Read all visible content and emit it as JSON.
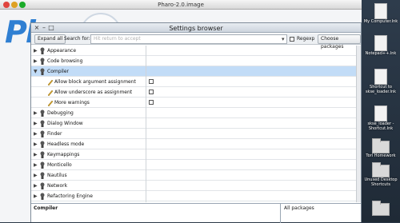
{
  "pharo_window": {
    "title": "Pharo-2.0.image",
    "logo_text": "Ph"
  },
  "settings": {
    "title": "Settings browser",
    "toolbar": {
      "expand_all": "Expand all",
      "search_label": "Search for:",
      "search_placeholder": "Hit return to accept",
      "dropdown_icon": "▾",
      "regexp_label": "Regexp",
      "choose_packages": "Choose packages"
    },
    "tree_rows": [
      {
        "label": "Appearance",
        "expanded": false
      },
      {
        "label": "Code browsing",
        "expanded": false
      },
      {
        "label": "Compiler",
        "expanded": true,
        "selected": true
      },
      {
        "label": "Allow block argument assignment",
        "child": true
      },
      {
        "label": "Allow underscore as assignment",
        "child": true
      },
      {
        "label": "More warnings",
        "child": true
      },
      {
        "label": "Debugging",
        "expanded": false
      },
      {
        "label": "Dialog Window",
        "expanded": false
      },
      {
        "label": "Finder",
        "expanded": false
      },
      {
        "label": "Headless mode",
        "expanded": false
      },
      {
        "label": "Keymappings",
        "expanded": false
      },
      {
        "label": "Monticello",
        "expanded": false
      },
      {
        "label": "Nautilus",
        "expanded": false
      },
      {
        "label": "Network",
        "expanded": false
      },
      {
        "label": "Refactoring Engine",
        "expanded": false
      }
    ],
    "bottom": {
      "left_label": "Compiler",
      "right_label": "All packages"
    }
  },
  "desktop_icons": [
    {
      "label": "My Computer.lnk",
      "kind": "doc"
    },
    {
      "label": "Notepad++.lnk",
      "kind": "doc"
    },
    {
      "label": "Shortcut to skse_loader.lnk",
      "kind": "doc"
    },
    {
      "label": "skse_loader - Shortcut.lnk",
      "kind": "doc"
    },
    {
      "label": "Tori Homework",
      "kind": "folder"
    },
    {
      "label": "Unused Desktop Shortcuts",
      "kind": "folder"
    },
    {
      "label": "",
      "kind": "folder"
    }
  ],
  "colors": {
    "selection": "#c2dcf7",
    "logo": "#2f7fd2",
    "desktop": "#2b3847"
  }
}
